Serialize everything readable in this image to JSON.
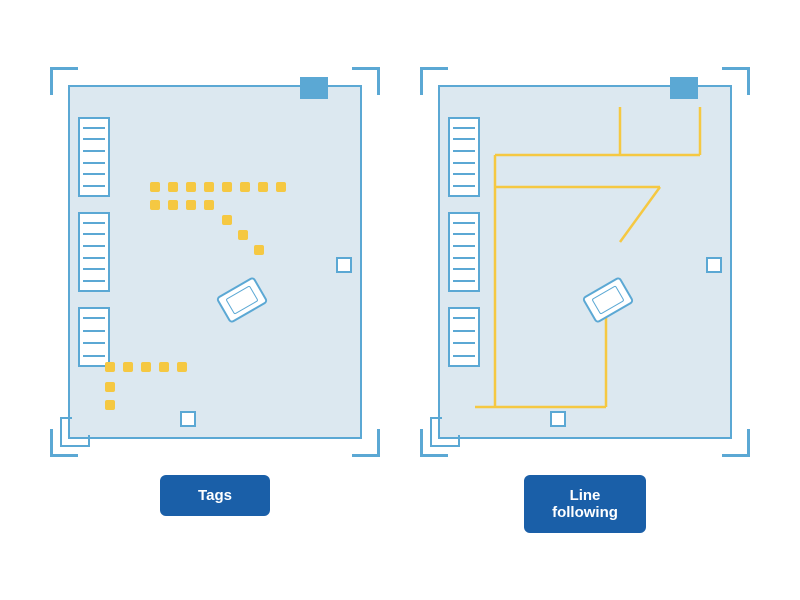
{
  "left_diagram": {
    "label": "Tags",
    "aria": "Tags navigation diagram showing dotted path"
  },
  "right_diagram": {
    "label": "Line\nfollowing",
    "aria": "Line following navigation diagram showing continuous line path"
  },
  "colors": {
    "room_bg": "#dce8f0",
    "border": "#5ba8d4",
    "accent": "#f5c842",
    "white": "#ffffff",
    "btn_bg": "#1a5fa8",
    "btn_text": "#ffffff"
  }
}
